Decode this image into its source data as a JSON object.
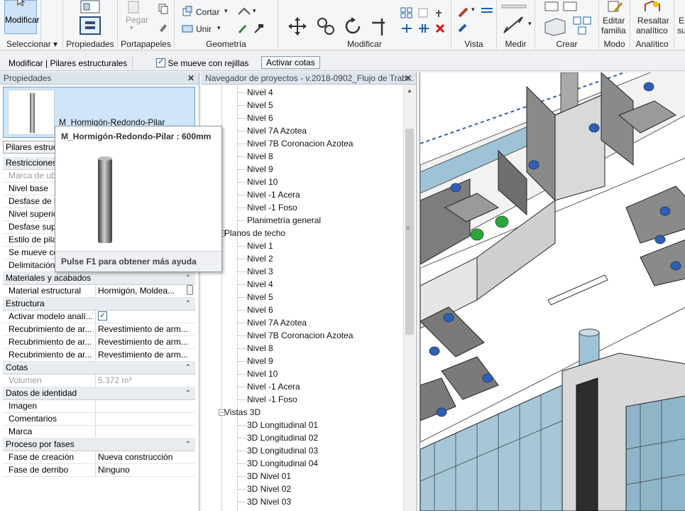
{
  "ribbon": {
    "modify_label": "Modificar",
    "clipboard": {
      "paste": "Pegar",
      "cut": "Cortar",
      "join": "Unir"
    },
    "panels": [
      {
        "label": "Seleccionar ▾"
      },
      {
        "label": "Propiedades"
      },
      {
        "label": "Portapapeles"
      },
      {
        "label": "Geometría"
      },
      {
        "label": "Modificar"
      },
      {
        "label": "Vista"
      },
      {
        "label": "Medir"
      },
      {
        "label": "Crear"
      },
      {
        "label": "Modo"
      },
      {
        "label": "Analítico"
      }
    ],
    "mode_button": "Editar familia",
    "mode_button_l1": "Editar",
    "mode_button_l2": "familia",
    "analytic_button_l1": "Resaltar",
    "analytic_button_l2": "analítico",
    "extra_l1": "E",
    "extra_l2": "su"
  },
  "optbar": {
    "context": "Modificar | Pilares estructurales",
    "moves_with_grids": "Se mueve con rejillas",
    "activate_dims": "Activar cotas"
  },
  "properties": {
    "title": "Propiedades",
    "type_name": "M_Hormigón-Redondo-Pilar",
    "type_size": "600mm",
    "instance_filter": "Pilares estructurales",
    "rows": [
      {
        "kind": "cat",
        "name": "Restricciones"
      },
      {
        "kind": "row",
        "name": "Marca de ubicación",
        "value": "",
        "gray": true
      },
      {
        "kind": "row",
        "name": "Nivel base",
        "value": ""
      },
      {
        "kind": "row",
        "name": "Desfase de base",
        "value": ""
      },
      {
        "kind": "row",
        "name": "Nivel superior",
        "value": ""
      },
      {
        "kind": "row",
        "name": "Desfase superior",
        "value": ""
      },
      {
        "kind": "row",
        "name": "Estilo de pilar",
        "value": ""
      },
      {
        "kind": "row",
        "name": "Se mueve con rejillas",
        "value": ""
      },
      {
        "kind": "row",
        "name": "Delimitación de habitación",
        "value": ""
      },
      {
        "kind": "cat",
        "name": "Materiales y acabados"
      },
      {
        "kind": "row",
        "name": "Material estructural",
        "value": "Hormigón, Moldea..."
      },
      {
        "kind": "cat",
        "name": "Estructura"
      },
      {
        "kind": "row",
        "name": "Activar modelo analí...",
        "value": "",
        "check": true
      },
      {
        "kind": "row",
        "name": "Recubrimiento de ar...",
        "value": "Revestimiento de arm..."
      },
      {
        "kind": "row",
        "name": "Recubrimiento de ar...",
        "value": "Revestimiento de arm..."
      },
      {
        "kind": "row",
        "name": "Recubrimiento de ar...",
        "value": "Revestimiento de arm..."
      },
      {
        "kind": "cat",
        "name": "Cotas"
      },
      {
        "kind": "row",
        "name": "Volumen",
        "value": "5.372 m³",
        "gray": true
      },
      {
        "kind": "cat",
        "name": "Datos de identidad"
      },
      {
        "kind": "row",
        "name": "Imagen",
        "value": ""
      },
      {
        "kind": "row",
        "name": "Comentarios",
        "value": ""
      },
      {
        "kind": "row",
        "name": "Marca",
        "value": ""
      },
      {
        "kind": "cat",
        "name": "Proceso por fases"
      },
      {
        "kind": "row",
        "name": "Fase de creación",
        "value": "Nueva construcción"
      },
      {
        "kind": "row",
        "name": "Fase de derribo",
        "value": "Ninguno"
      }
    ]
  },
  "tooltip": {
    "title": "M_Hormigón-Redondo-Pilar : 600mm",
    "footer": "Pulse F1 para obtener más ayuda"
  },
  "browser": {
    "title": "Navegador de proyectos - v.2018-0902_Flujo de Trab...",
    "nodes": [
      {
        "label": "Nivel 4",
        "level": 2
      },
      {
        "label": "Nivel 5",
        "level": 2
      },
      {
        "label": "Nivel 6",
        "level": 2
      },
      {
        "label": "Nivel 7A Azotea",
        "level": 2
      },
      {
        "label": "Nivel 7B Coronacion Azotea",
        "level": 2
      },
      {
        "label": "Nivel 8",
        "level": 2
      },
      {
        "label": "Nivel 9",
        "level": 2
      },
      {
        "label": "Nivel 10",
        "level": 2
      },
      {
        "label": "Nivel -1 Acera",
        "level": 2
      },
      {
        "label": "Nivel -1 Foso",
        "level": 2
      },
      {
        "label": "Planimetría general",
        "level": 2
      },
      {
        "label": "Planos de techo",
        "level": 1,
        "expander": "−"
      },
      {
        "label": "Nivel 1",
        "level": 2
      },
      {
        "label": "Nivel 2",
        "level": 2
      },
      {
        "label": "Nivel 3",
        "level": 2
      },
      {
        "label": "Nivel 4",
        "level": 2
      },
      {
        "label": "Nivel 5",
        "level": 2
      },
      {
        "label": "Nivel 6",
        "level": 2
      },
      {
        "label": "Nivel 7A Azotea",
        "level": 2
      },
      {
        "label": "Nivel 7B Coronacion Azotea",
        "level": 2
      },
      {
        "label": "Nivel 8",
        "level": 2
      },
      {
        "label": "Nivel 9",
        "level": 2
      },
      {
        "label": "Nivel 10",
        "level": 2
      },
      {
        "label": "Nivel -1 Acera",
        "level": 2
      },
      {
        "label": "Nivel -1 Foso",
        "level": 2
      },
      {
        "label": "Vistas 3D",
        "level": 1,
        "expander": "−"
      },
      {
        "label": "3D Longitudinal 01",
        "level": 2
      },
      {
        "label": "3D Longitudinal 02",
        "level": 2
      },
      {
        "label": "3D Longitudinal 03",
        "level": 2
      },
      {
        "label": "3D Longitudinal 04",
        "level": 2
      },
      {
        "label": "3D Nivel 01",
        "level": 2
      },
      {
        "label": "3D Nivel 02",
        "level": 2
      },
      {
        "label": "3D Nivel 03",
        "level": 2
      }
    ]
  },
  "colors": {
    "selection_blue": "#cfe5fa",
    "chair_blue": "#2f5fb3",
    "chair_green": "#2ea33a",
    "glass": "#9fc3d6"
  }
}
